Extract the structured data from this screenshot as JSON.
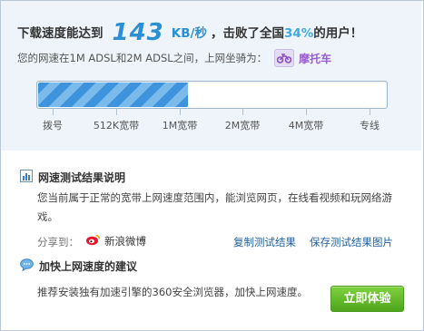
{
  "result": {
    "headline_prefix": "下载速度能达到",
    "speed_value": "143",
    "speed_unit": "KB/秒",
    "headline_middle": "，击败了全国",
    "beat_percent": "34%",
    "headline_suffix": "的用户！",
    "subline_text": "您的网速在1M ADSL和2M ADSL之间，上网坐骑为：",
    "vehicle_name": "摩托车",
    "vehicle_icon": "motorcycle-icon"
  },
  "meter": {
    "fill_fraction": 0.43,
    "tick_labels": [
      "拨号",
      "512K宽带",
      "1M宽带",
      "2M宽带",
      "4M宽带",
      "专线"
    ],
    "colors": {
      "fill_dark": "#3d93dc",
      "fill_light": "#7bbbec",
      "border": "#9db7d1"
    }
  },
  "explanation": {
    "title": "网速测试结果说明",
    "icon": "bar-chart-icon",
    "text": "您当前属于正常的宽带上网速度范围内，能浏览网页，在线看视频和玩网络游戏。",
    "share_label": "分享到：",
    "weibo_label": "新浪微博",
    "weibo_icon": "weibo-icon",
    "copy_link": "复制测试结果",
    "save_link": "保存测试结果图片"
  },
  "suggestion": {
    "title": "加快上网速度的建议",
    "icon": "speech-bubble-icon",
    "text": "推荐安装独有加速引擎的360安全浏览器，加快上网速度。",
    "button_label": "立即体验"
  }
}
